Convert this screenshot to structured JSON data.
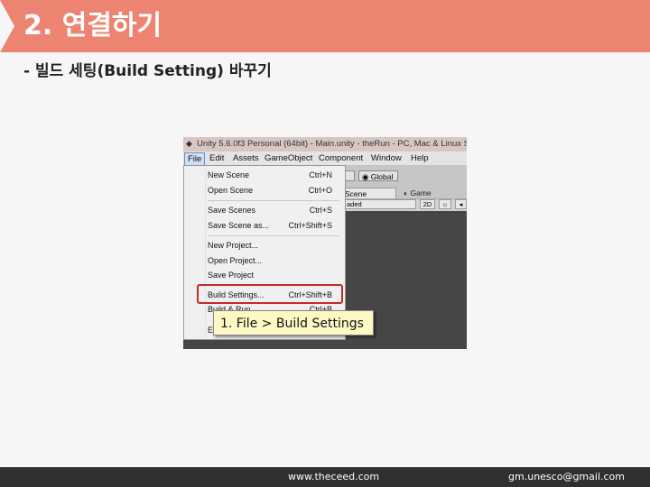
{
  "header": {
    "title": "2. 연결하기"
  },
  "subtitle": "- 빌드 세팅(Build Setting) 바꾸기",
  "footer": {
    "website": "www.theceed.com",
    "email": "gm.unesco@gmail.com"
  },
  "screenshot": {
    "title_bar": "Unity 5.6.0f3 Personal (64bit) - Main.unity - theRun - PC, Mac & Linux Sta",
    "menu_bar": [
      "File",
      "Edit",
      "Assets",
      "GameObject",
      "Component",
      "Window",
      "Help"
    ],
    "toolbar": {
      "center_button": "t",
      "global_button": "Global"
    },
    "tabs": {
      "scene": "Scene",
      "game": "Game"
    },
    "scene_bar": {
      "shading": "aded",
      "mode_2d": "2D",
      "light_icon": "☼",
      "audio_icon": "◂"
    },
    "file_menu": [
      {
        "label": "New Scene",
        "shortcut": "Ctrl+N"
      },
      {
        "label": "Open Scene",
        "shortcut": "Ctrl+O"
      },
      {
        "label": "Save Scenes",
        "shortcut": "Ctrl+S"
      },
      {
        "label": "Save Scene as...",
        "shortcut": "Ctrl+Shift+S"
      },
      {
        "label": "New Project...",
        "shortcut": ""
      },
      {
        "label": "Open Project...",
        "shortcut": ""
      },
      {
        "label": "Save Project",
        "shortcut": ""
      },
      {
        "label": "Build Settings...",
        "shortcut": "Ctrl+Shift+B"
      },
      {
        "label": "Build & Run",
        "shortcut": "Ctrl+B"
      },
      {
        "label": "Exit",
        "shortcut": ""
      }
    ],
    "highlight_color": "#c32a2a"
  },
  "callout": "1. File > Build Settings",
  "colors": {
    "header_bg": "#ed8472",
    "footer_bg": "#303030",
    "callout_bg": "#fdf8c4"
  }
}
